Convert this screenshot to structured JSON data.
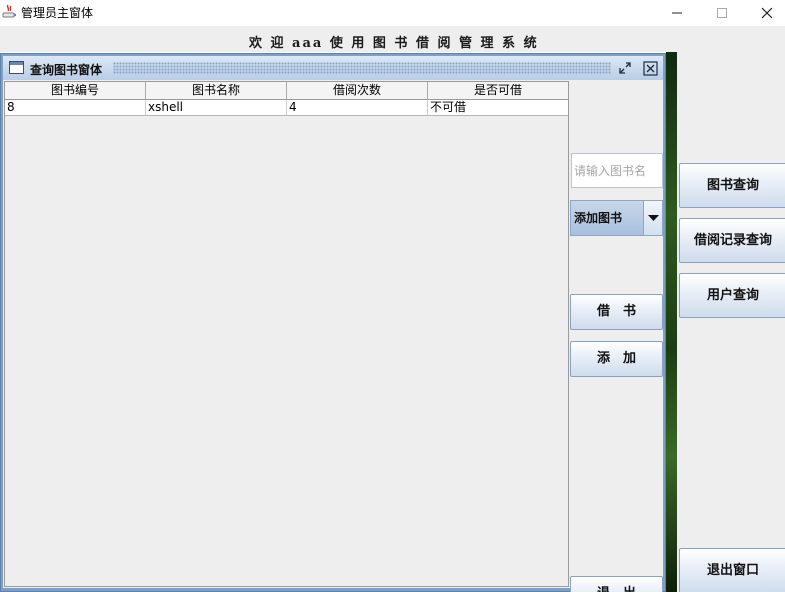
{
  "window": {
    "title": "管理员主窗体",
    "minimize_glyph": "minimize-icon",
    "maximize_glyph": "maximize-icon",
    "close_glyph": "close-icon"
  },
  "welcome": {
    "text": "欢 迎 aaa 使 用 图 书 借 阅 管 理 系 统"
  },
  "internal_frame": {
    "title": "查询图书窗体",
    "icon": "frame-icon",
    "restore_icon": "restore-icon",
    "close_icon": "close-icon"
  },
  "table": {
    "headers": [
      "图书编号",
      "图书名称",
      "借阅次数",
      "是否可借"
    ],
    "rows": [
      [
        "8",
        "xshell",
        "4",
        "不可借"
      ]
    ]
  },
  "controls": {
    "search_placeholder": "请输入图书名",
    "combo_selected": "添加图书",
    "borrow_label": "借　书",
    "add_label": "添　加",
    "exit_label": "退　出"
  },
  "right_panel": {
    "book_query": "图书查询",
    "borrow_record_query": "借阅记录查询",
    "user_query": "用户查询",
    "exit_window": "退出窗口"
  },
  "colors": {
    "frame_border": "#7ea0c8",
    "title_gradient_top": "#dde8f5",
    "button_border": "#8aa2bf"
  }
}
